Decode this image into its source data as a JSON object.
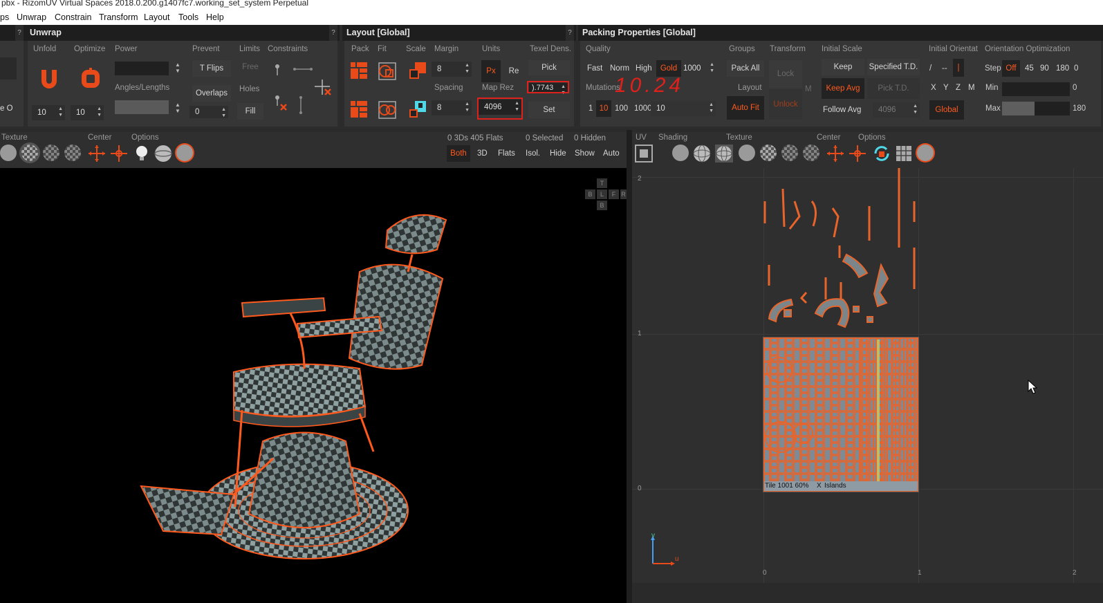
{
  "window": {
    "title": "pbx - RizomUV  Virtual Spaces 2018.0.200.g1407fc7.working_set_system Perpetual"
  },
  "menu": [
    "ps",
    "Unwrap",
    "Constrain",
    "Transform",
    "Layout",
    "Tools",
    "Help"
  ],
  "unwrap": {
    "title": "Unwrap",
    "help": "?",
    "labels": {
      "unfold": "Unfold",
      "optimize": "Optimize",
      "power": "Power",
      "prevent": "Prevent",
      "limits": "Limits",
      "constraints": "Constraints",
      "angles": "Angles/Lengths",
      "holes": "Holes"
    },
    "buttons": {
      "tflips": "T Flips",
      "overlaps": "Overlaps",
      "free": "Free",
      "fill": "Fill"
    },
    "values": {
      "unfold_iter": "10",
      "optimize_iter": "10",
      "overlaps_val": "0"
    },
    "left_cut": "e O"
  },
  "layout": {
    "title": "Layout [Global]",
    "help": "?",
    "labels": {
      "pack": "Pack",
      "fit": "Fit",
      "scale": "Scale",
      "margin": "Margin",
      "units": "Units",
      "texel": "Texel Dens.",
      "spacing": "Spacing",
      "maprez": "Map Rez"
    },
    "values": {
      "margin": "8",
      "spacing": "8",
      "texel": ").7743",
      "maprez": "4096"
    },
    "buttons": {
      "px": "Px",
      "re": "Re",
      "pick": "Pick",
      "set": "Set"
    }
  },
  "packing": {
    "title": "Packing Properties [Global]",
    "labels": {
      "quality": "Quality",
      "groups": "Groups",
      "transform": "Transform",
      "initial_scale": "Initial Scale",
      "initial_orient": "Initial Orientat",
      "orient_opt": "Orientation Optimization",
      "mutations": "Mutations",
      "layout": "Layout"
    },
    "quality": [
      "Fast",
      "Norm",
      "High",
      "Gold"
    ],
    "quality_value": "1000",
    "mutations": [
      "1",
      "10",
      "100",
      "1000"
    ],
    "mutations_value": "10",
    "buttons": {
      "pack_all": "Pack All",
      "lock": "Lock",
      "unlock": "Unlock",
      "auto_fit": "Auto Fit",
      "m": "M",
      "keep": "Keep",
      "specified": "Specified T.D.",
      "keep_avg": "Keep Avg",
      "pick_td": "Pick T.D.",
      "follow_avg": "Follow Avg",
      "global": "Global"
    },
    "follow_value": "4096",
    "orient_axes": [
      "/",
      "--",
      "|"
    ],
    "orient_xyz": [
      "X",
      "Y",
      "Z",
      "M"
    ],
    "step_label": "Step",
    "steps": [
      "Off",
      "45",
      "90",
      "180",
      "0"
    ],
    "min_label": "Min",
    "min_value": "0",
    "max_label": "Max",
    "max_value": "180",
    "annotation": "10.24"
  },
  "view3d_bar": {
    "labels": {
      "texture": "Texture",
      "center": "Center",
      "options": "Options"
    },
    "stats": {
      "counts": "0 3Ds 405 Flats",
      "selected": "0 Selected",
      "hidden": "0 Hidden"
    },
    "buttons": [
      "Both",
      "3D",
      "Flats",
      "Isol.",
      "Hide",
      "Show",
      "Auto"
    ]
  },
  "viewuv_bar": {
    "labels": {
      "uv": "UV",
      "shading": "Shading",
      "texture": "Texture",
      "center": "Center",
      "options": "Options"
    }
  },
  "navcube": [
    "T",
    "B",
    "L",
    "F",
    "R",
    "B"
  ],
  "uv": {
    "axis_labels": {
      "v2": "2",
      "v1": "1",
      "v0": "0",
      "u0": "0",
      "u1": "1",
      "u2": "2"
    },
    "tile_label": "Tile 1001 60%",
    "x_label": "X",
    "islands_label": "Islands",
    "gizmo_v": "v",
    "gizmo_u": "u"
  },
  "colors": {
    "accent": "#ff5a1e",
    "panel": "#363636",
    "header": "#1e1e1e",
    "viewport3d": "#000000",
    "viewportuv": "#2f2f2f",
    "highlight": "#e0201a"
  }
}
